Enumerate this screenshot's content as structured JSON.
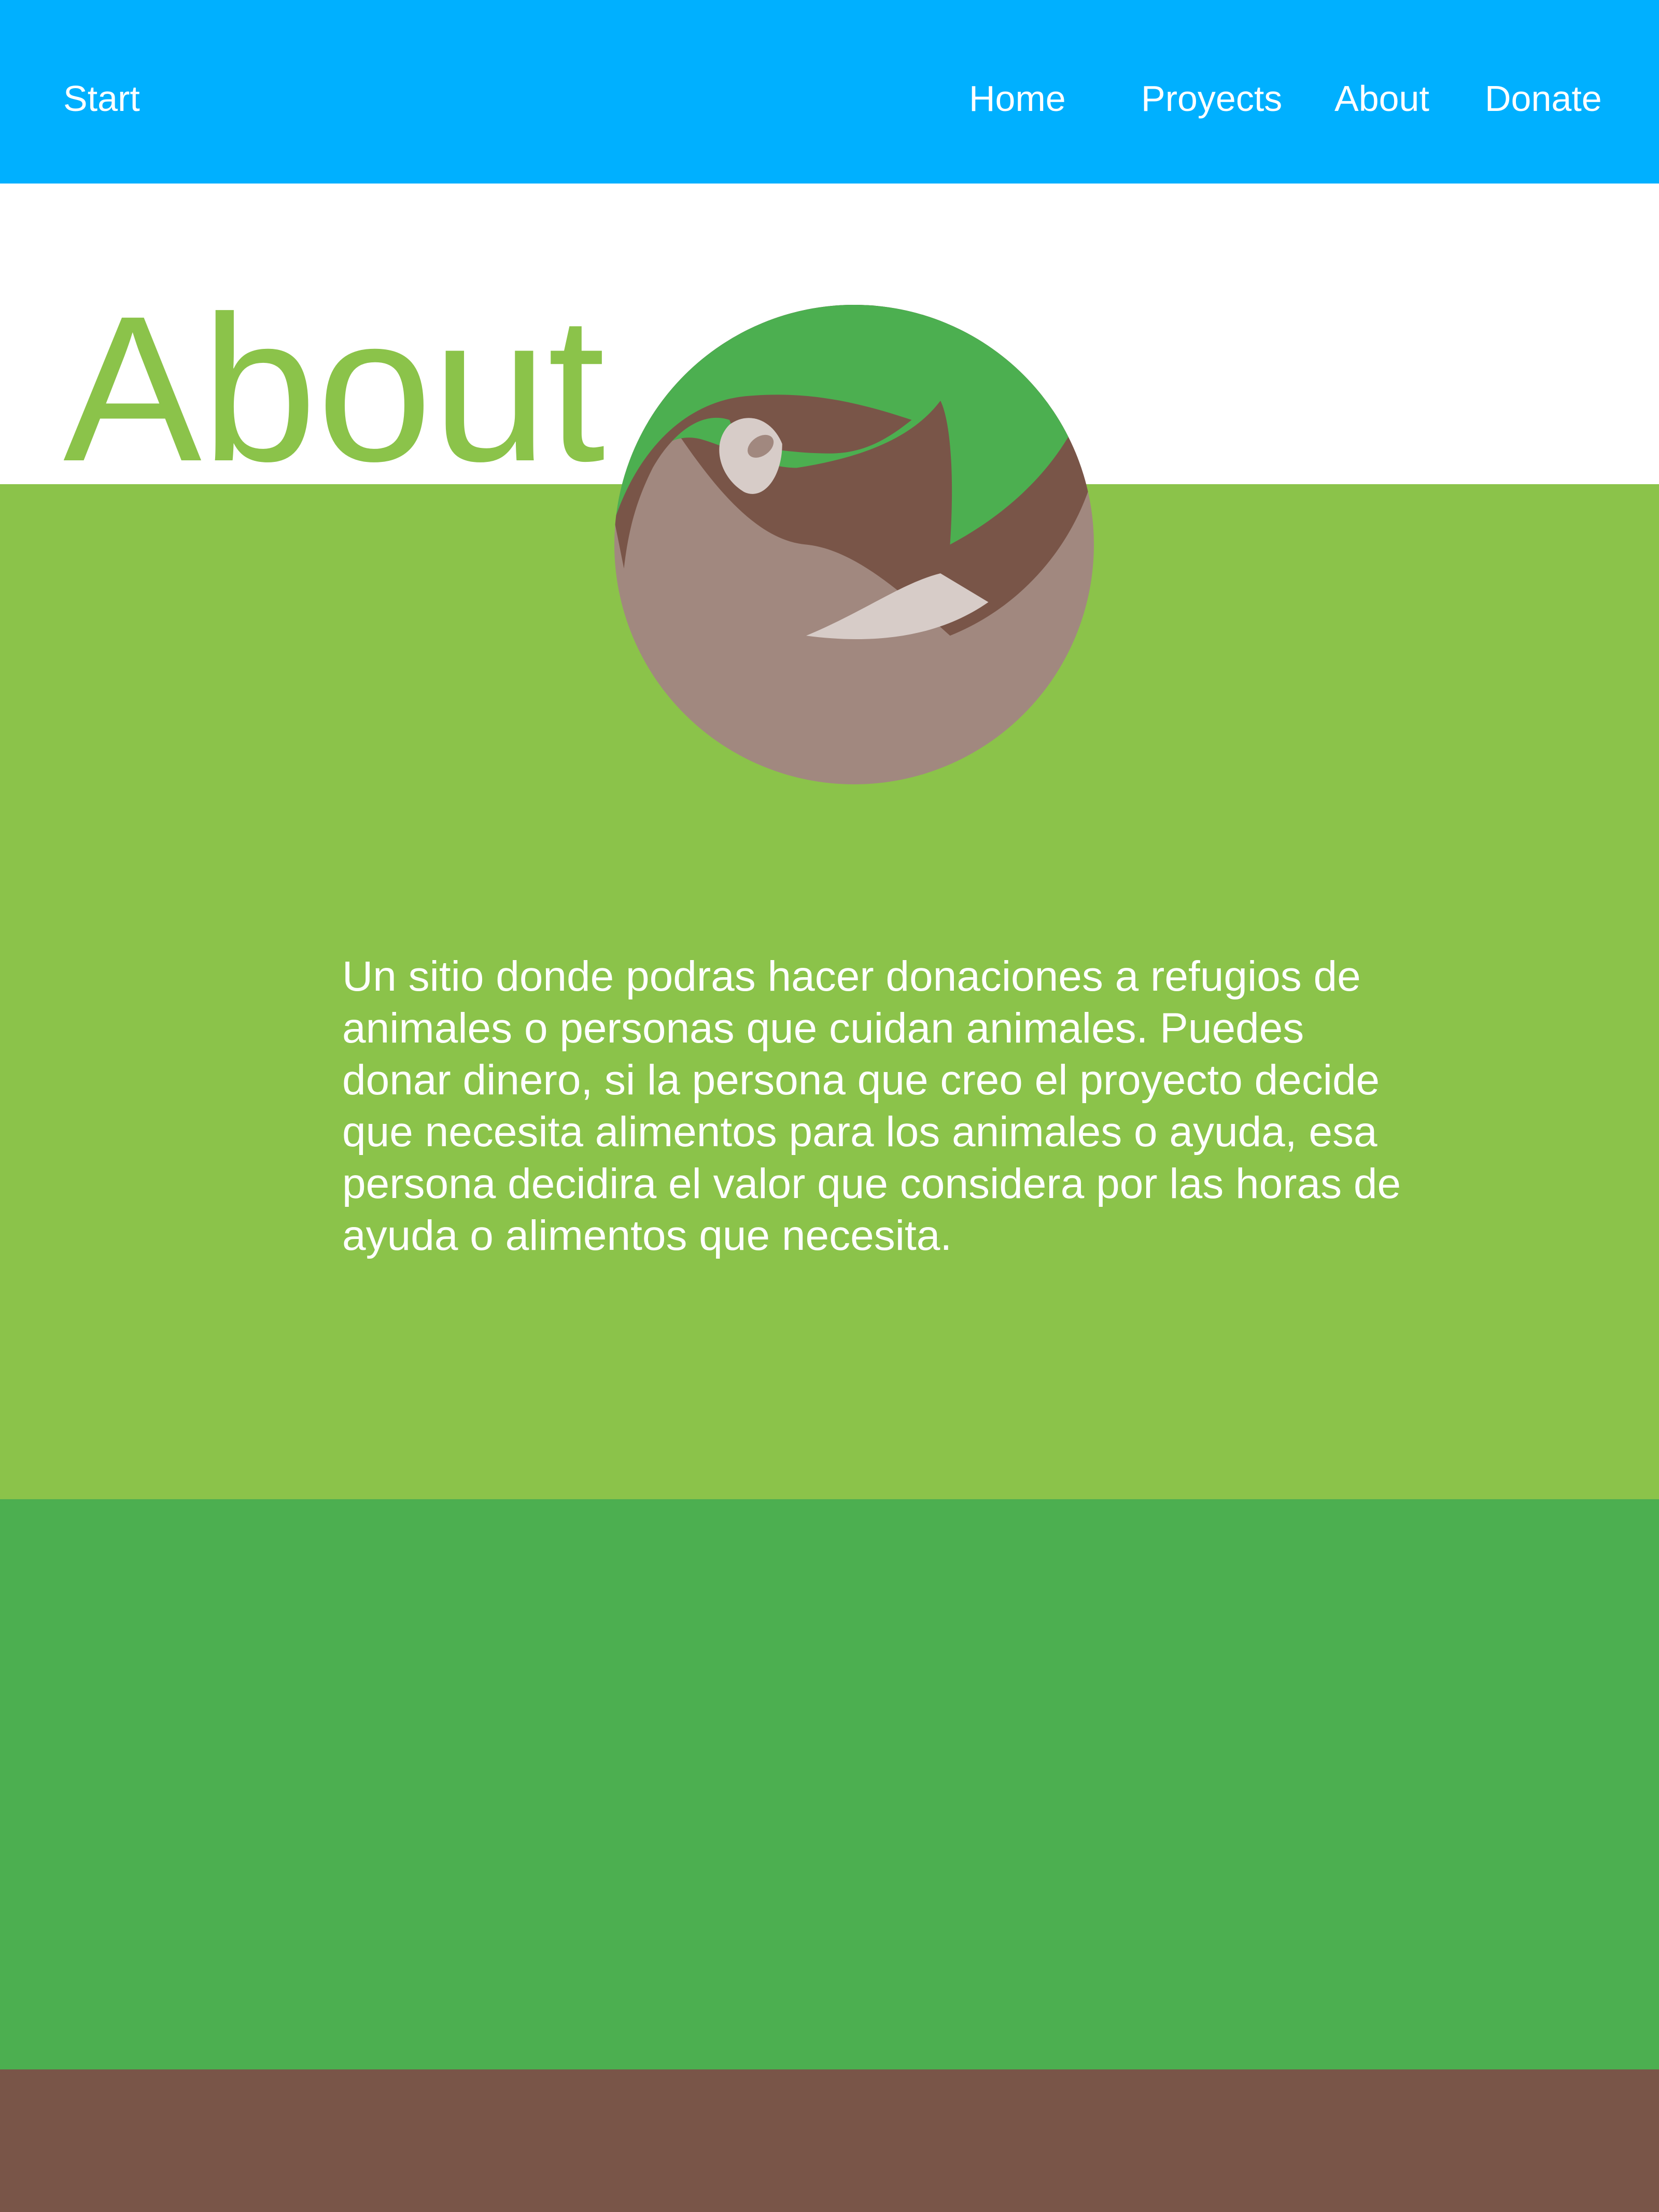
{
  "nav": {
    "brand": "Start",
    "items": [
      {
        "label": "Home"
      },
      {
        "label": "Proyects"
      },
      {
        "label": "About"
      },
      {
        "label": "Donate"
      }
    ]
  },
  "hero": {
    "title": "About"
  },
  "about": {
    "description": "Un sitio donde podras hacer donaciones a refugios de animales o personas que cuidan animales. Puedes donar dinero, si la persona que creo el proyecto decide que necesita alimentos para los animales o ayuda, esa persona decidira el valor que considera por las horas de ayuda o alimentos que necesita."
  },
  "logo": {
    "icon": "sloth-logo-icon"
  },
  "colors": {
    "header": "#00b0ff",
    "light_green": "#8bc34a",
    "green": "#4caf50",
    "brown": "#795548",
    "sloth_fur": "#a1887f",
    "sloth_face": "#d7ccc8"
  }
}
